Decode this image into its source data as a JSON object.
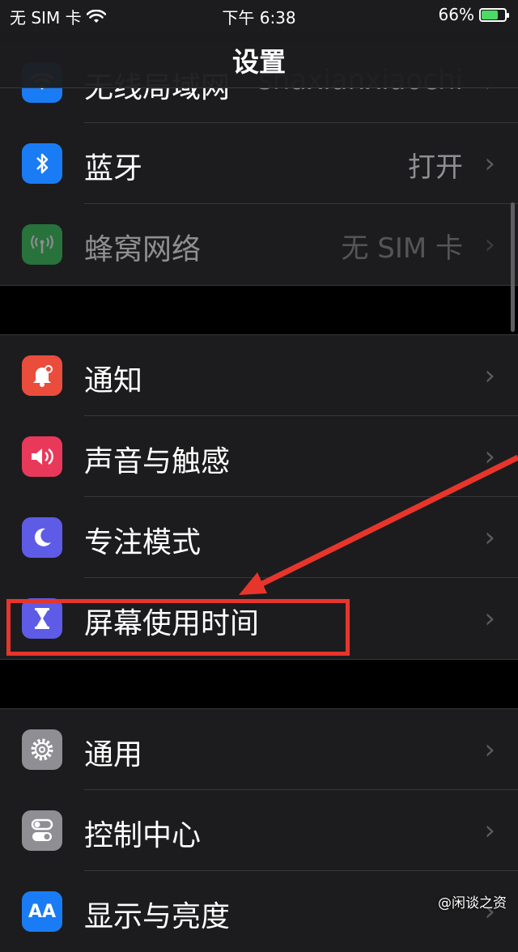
{
  "status": {
    "carrier": "无 SIM 卡",
    "time": "下午 6:38",
    "battery": "66%",
    "battery_level": 0.66
  },
  "nav": {
    "title": "设置"
  },
  "rows": {
    "wifi": {
      "label": "无线局域网",
      "value": "shaxianxiaochi",
      "icon": "wifi-icon",
      "color": "#1a7cf5"
    },
    "bluetooth": {
      "label": "蓝牙",
      "value": "打开",
      "icon": "bluetooth-icon",
      "color": "#1a7cf5"
    },
    "cellular": {
      "label": "蜂窝网络",
      "value": "无 SIM 卡",
      "icon": "antenna-icon",
      "color": "#34c759"
    },
    "notifications": {
      "label": "通知",
      "icon": "bell-icon",
      "color": "#eb4d3d"
    },
    "sounds": {
      "label": "声音与触感",
      "icon": "speaker-icon",
      "color": "#e9395a"
    },
    "focus": {
      "label": "专注模式",
      "icon": "moon-icon",
      "color": "#5e5ce6"
    },
    "screentime": {
      "label": "屏幕使用时间",
      "icon": "hourglass-icon",
      "color": "#5e5ce6"
    },
    "general": {
      "label": "通用",
      "icon": "gear-icon",
      "color": "#8e8e93"
    },
    "control": {
      "label": "控制中心",
      "icon": "toggles-icon",
      "color": "#8e8e93"
    },
    "display": {
      "label": "显示与亮度",
      "icon": "text-size-icon",
      "color": "#1a7cf5"
    }
  },
  "chevron": "›",
  "annotation_color": "#e8352c",
  "watermark": "@闲谈之资"
}
